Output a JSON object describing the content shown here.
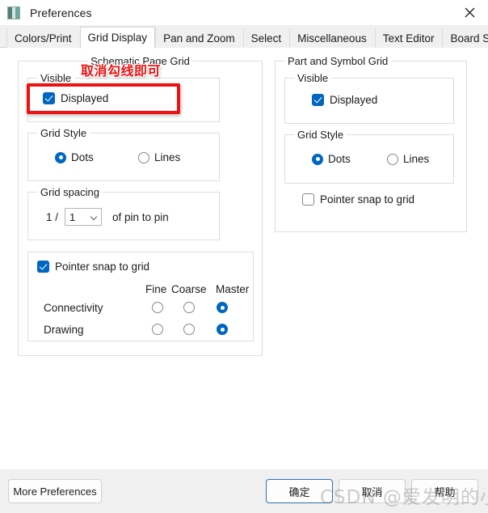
{
  "window": {
    "title": "Preferences",
    "icon": "app-icon",
    "close_icon": "close-icon"
  },
  "tabs": [
    {
      "label": "Colors/Print",
      "active": false
    },
    {
      "label": "Grid Display",
      "active": true
    },
    {
      "label": "Pan and Zoom",
      "active": false
    },
    {
      "label": "Select",
      "active": false
    },
    {
      "label": "Miscellaneous",
      "active": false
    },
    {
      "label": "Text Editor",
      "active": false
    },
    {
      "label": "Board Simulation",
      "active": false
    }
  ],
  "schematic_page_grid": {
    "legend": "Schematic Page Grid",
    "visible": {
      "legend": "Visible",
      "displayed_label": "Displayed",
      "displayed_checked": true
    },
    "grid_style": {
      "legend": "Grid Style",
      "dots_label": "Dots",
      "lines_label": "Lines",
      "selected": "Dots"
    },
    "grid_spacing": {
      "legend": "Grid spacing",
      "prefix": "1 /",
      "value": "1",
      "suffix": "of pin to pin"
    },
    "pointer_snap": {
      "label": "Pointer snap to grid",
      "checked": true,
      "columns": [
        "Fine",
        "Coarse",
        "Master"
      ],
      "rows": [
        {
          "label": "Connectivity",
          "selected": "Master"
        },
        {
          "label": "Drawing",
          "selected": "Master"
        }
      ]
    }
  },
  "part_symbol_grid": {
    "legend": "Part and Symbol Grid",
    "visible": {
      "legend": "Visible",
      "displayed_label": "Displayed",
      "displayed_checked": true
    },
    "grid_style": {
      "legend": "Grid Style",
      "dots_label": "Dots",
      "lines_label": "Lines",
      "selected": "Dots"
    },
    "pointer_snap": {
      "label": "Pointer snap to grid",
      "checked": false
    }
  },
  "annotation": {
    "text": "取消勾线即可",
    "color": "#ee1111"
  },
  "footer": {
    "more_preferences": "More Preferences",
    "ok": "确定",
    "cancel": "取消",
    "help": "帮助"
  },
  "watermark": {
    "text": "CSDN @爱发明的小兴"
  },
  "colors": {
    "accent": "#0067c0",
    "annotation_red": "#ee1111",
    "primary_button_border": "#2a72b5",
    "window_bg": "#f0f0f0",
    "page_bg": "#ffffff"
  }
}
